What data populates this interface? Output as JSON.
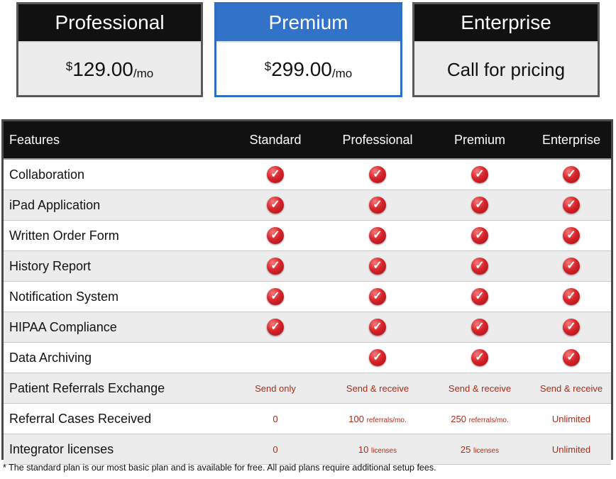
{
  "plans": [
    {
      "name": "Professional",
      "currency": "$",
      "amount": "129.00",
      "period": "/mo"
    },
    {
      "name": "Premium",
      "currency": "$",
      "amount": "299.00",
      "period": "/mo"
    },
    {
      "name": "Enterprise",
      "price_text": "Call for pricing"
    }
  ],
  "table": {
    "headers": [
      "Features",
      "Standard",
      "Professional",
      "Premium",
      "Enterprise"
    ],
    "rows": [
      {
        "feature": "Collaboration",
        "cells": [
          "check",
          "check",
          "check",
          "check"
        ]
      },
      {
        "feature": "iPad Application",
        "cells": [
          "check",
          "check",
          "check",
          "check"
        ]
      },
      {
        "feature": "Written Order Form",
        "cells": [
          "check",
          "check",
          "check",
          "check"
        ]
      },
      {
        "feature": "History Report",
        "cells": [
          "check",
          "check",
          "check",
          "check"
        ]
      },
      {
        "feature": "Notification System",
        "cells": [
          "check",
          "check",
          "check",
          "check"
        ]
      },
      {
        "feature": "HIPAA Compliance",
        "cells": [
          "check",
          "check",
          "check",
          "check"
        ]
      },
      {
        "feature": "Data Archiving",
        "cells": [
          "",
          "check",
          "check",
          "check"
        ]
      },
      {
        "feature": "Patient Referrals Exchange",
        "cells": [
          "Send only",
          "Send & receive",
          "Send & receive",
          "Send & receive"
        ]
      },
      {
        "feature": "Referral Cases Received",
        "cells": [
          "0",
          {
            "num": "100",
            "unit": "referrals/mo."
          },
          {
            "num": "250",
            "unit": "referrals/mo."
          },
          "Unlimited"
        ]
      },
      {
        "feature": "Integrator licenses",
        "cells": [
          "0",
          {
            "num": "10",
            "unit": "licenses"
          },
          {
            "num": "25",
            "unit": "licenses"
          },
          "Unlimited"
        ]
      }
    ]
  },
  "footnote": "* The standard plan is our most basic plan and is available for free. All paid plans require additional setup fees.",
  "colors": {
    "premium_accent": "#3273c9",
    "check": "#d8242a",
    "value_text": "#b02a18"
  },
  "icons": {
    "check": "check-circle-icon"
  }
}
